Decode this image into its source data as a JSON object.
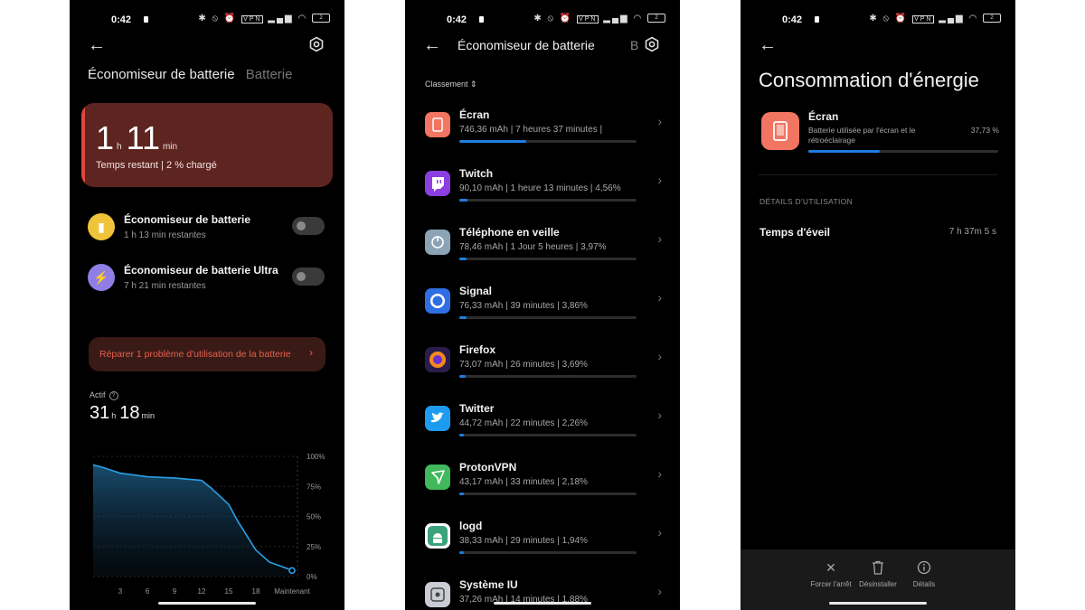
{
  "status_bar": {
    "time": "0:42",
    "vpn": "VPN",
    "battery_level": "2"
  },
  "screen1": {
    "tabs": [
      "Économiseur de batterie",
      "Batterie"
    ],
    "remaining": {
      "hours": "1",
      "h_unit": "h",
      "minutes": "11",
      "m_unit": "min",
      "label": "Temps restant | 2 % chargé"
    },
    "modes": [
      {
        "title": "Économiseur de batterie",
        "subtitle": "1 h 13 min restantes",
        "icon": "battery-icon",
        "color": "#f0c43a",
        "enabled": false
      },
      {
        "title": "Économiseur de batterie Ultra",
        "subtitle": "7 h 21 min restantes",
        "icon": "lightning-icon",
        "color": "#8f7ee6",
        "enabled": false
      }
    ],
    "repair_label": "Réparer 1 problème d'utilisation de la batterie",
    "active": {
      "label": "Actif",
      "hours": "31",
      "h_unit": "h",
      "minutes": "18",
      "m_unit": "min"
    }
  },
  "chart_data": {
    "type": "area",
    "x": [
      0,
      1,
      3,
      6,
      9,
      12,
      13,
      15,
      16,
      18,
      19.5,
      21,
      22
    ],
    "y": [
      93,
      91,
      86,
      83,
      82,
      80,
      74,
      60,
      46,
      22,
      12,
      8,
      5
    ],
    "x_tick_labels": [
      "3",
      "6",
      "12",
      "15",
      "18",
      "Maintenant"
    ],
    "x_tick_values": [
      3,
      6,
      12,
      15,
      18,
      22
    ],
    "extra_x_tick": {
      "label": "9",
      "value": 9
    },
    "y_tick_labels": [
      "100%",
      "75%",
      "50%",
      "25%",
      "0%"
    ],
    "y_tick_values": [
      100,
      75,
      50,
      25,
      0
    ],
    "ylim": [
      0,
      100
    ],
    "xlim": [
      0,
      22
    ],
    "color": "#29a0e8"
  },
  "screen2": {
    "title": "Économiseur de batterie",
    "title_cut": "B",
    "sort_label": "Classement",
    "apps": [
      {
        "name": "Écran",
        "stats": "746,36 mAh | 7 heures 37 minutes  |",
        "usage": 0.377,
        "icon": "screen-icon",
        "color": "#f27561"
      },
      {
        "name": "Twitch",
        "stats": "90,10 mAh | 1 heure 13 minutes  | 4,56%",
        "usage": 0.046,
        "icon": "twitch-icon",
        "color": "#8b3fe0"
      },
      {
        "name": "Téléphone en veille",
        "stats": "78,46 mAh | 1 Jour 5 heures  | 3,97%",
        "usage": 0.04,
        "icon": "power-icon",
        "color": "#8aa4b6"
      },
      {
        "name": "Signal",
        "stats": "76,33 mAh | 39 minutes  | 3,86%",
        "usage": 0.039,
        "icon": "signal-icon",
        "color": "#2f6fe3"
      },
      {
        "name": "Firefox",
        "stats": "73,07 mAh | 26 minutes  | 3,69%",
        "usage": 0.037,
        "icon": "firefox-icon",
        "color": "#f58a1f"
      },
      {
        "name": "Twitter",
        "stats": "44,72 mAh | 22 minutes  | 2,26%",
        "usage": 0.023,
        "icon": "twitter-icon",
        "color": "#1d9bf0"
      },
      {
        "name": "ProtonVPN",
        "stats": "43,17 mAh | 33 minutes  | 2,18%",
        "usage": 0.022,
        "icon": "protonvpn-icon",
        "color": "#41b85c"
      },
      {
        "name": "logd",
        "stats": "38,33 mAh | 29 minutes  | 1,94%",
        "usage": 0.019,
        "icon": "android-icon",
        "color": "#3aa27a"
      },
      {
        "name": "Système IU",
        "stats": "37,26 mAh | 14 minutes  | 1,88%",
        "usage": 0.019,
        "icon": "system-ui-icon",
        "color": "#c9ccd4"
      }
    ]
  },
  "screen3": {
    "title": "Consommation d'énergie",
    "app_name": "Écran",
    "app_desc": "Batterie utilisée par l'écran et le rétroéclairage",
    "app_pct": "37,73 %",
    "usage": 0.377,
    "section": "DÉTAILS D'UTILISATION",
    "wake_label": "Temps d'éveil",
    "wake_value": "7 h 37m 5 s",
    "actions": [
      "Forcer l'arrêt",
      "Désinstaller",
      "Détails"
    ]
  }
}
